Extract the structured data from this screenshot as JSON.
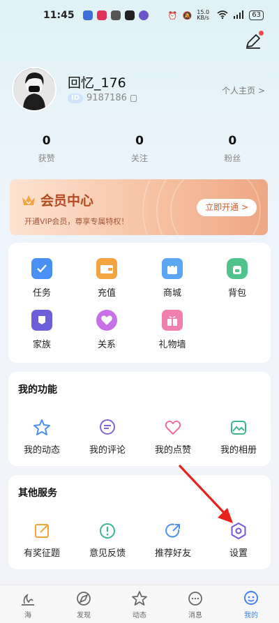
{
  "status_bar": {
    "time": "11:45",
    "network_speed": "15.0 KB/s",
    "battery": "63"
  },
  "profile": {
    "username": "回忆_176",
    "id_badge": "ID",
    "id_value": "9187186",
    "homepage_link": "个人主页 >"
  },
  "stats": [
    {
      "value": "0",
      "label": "获赞"
    },
    {
      "value": "0",
      "label": "关注"
    },
    {
      "value": "0",
      "label": "粉丝"
    }
  ],
  "vip": {
    "title": "会员中心",
    "subtitle": "开通VIP会员，尊享专属特权！",
    "button": "立即开通 >"
  },
  "grid": [
    {
      "label": "任务",
      "icon": "task-icon"
    },
    {
      "label": "充值",
      "icon": "wallet-icon"
    },
    {
      "label": "商城",
      "icon": "shopping-bag-icon"
    },
    {
      "label": "背包",
      "icon": "backpack-icon"
    },
    {
      "label": "家族",
      "icon": "family-flag-icon"
    },
    {
      "label": "关系",
      "icon": "heart-icon"
    },
    {
      "label": "礼物墙",
      "icon": "gift-icon"
    }
  ],
  "my_functions": {
    "title": "我的功能",
    "items": [
      {
        "label": "我的动态",
        "icon": "star-icon"
      },
      {
        "label": "我的评论",
        "icon": "comment-icon"
      },
      {
        "label": "我的点赞",
        "icon": "like-heart-icon"
      },
      {
        "label": "我的相册",
        "icon": "album-icon"
      }
    ]
  },
  "other_services": {
    "title": "其他服务",
    "items": [
      {
        "label": "有奖征题",
        "icon": "edit-icon"
      },
      {
        "label": "意见反馈",
        "icon": "feedback-icon"
      },
      {
        "label": "推荐好友",
        "icon": "share-icon"
      },
      {
        "label": "设置",
        "icon": "settings-hexagon-icon"
      }
    ]
  },
  "tabbar": [
    {
      "label": "海",
      "icon": "sea-icon",
      "active": false
    },
    {
      "label": "发现",
      "icon": "discover-icon",
      "active": false
    },
    {
      "label": "动态",
      "icon": "feed-icon",
      "active": false
    },
    {
      "label": "消息",
      "icon": "message-icon",
      "active": false
    },
    {
      "label": "我的",
      "icon": "profile-icon",
      "active": true
    }
  ],
  "colors": {
    "accent": "#3e7ef5",
    "vip_text": "#b34a22",
    "annotation_arrow": "#e8211f"
  }
}
